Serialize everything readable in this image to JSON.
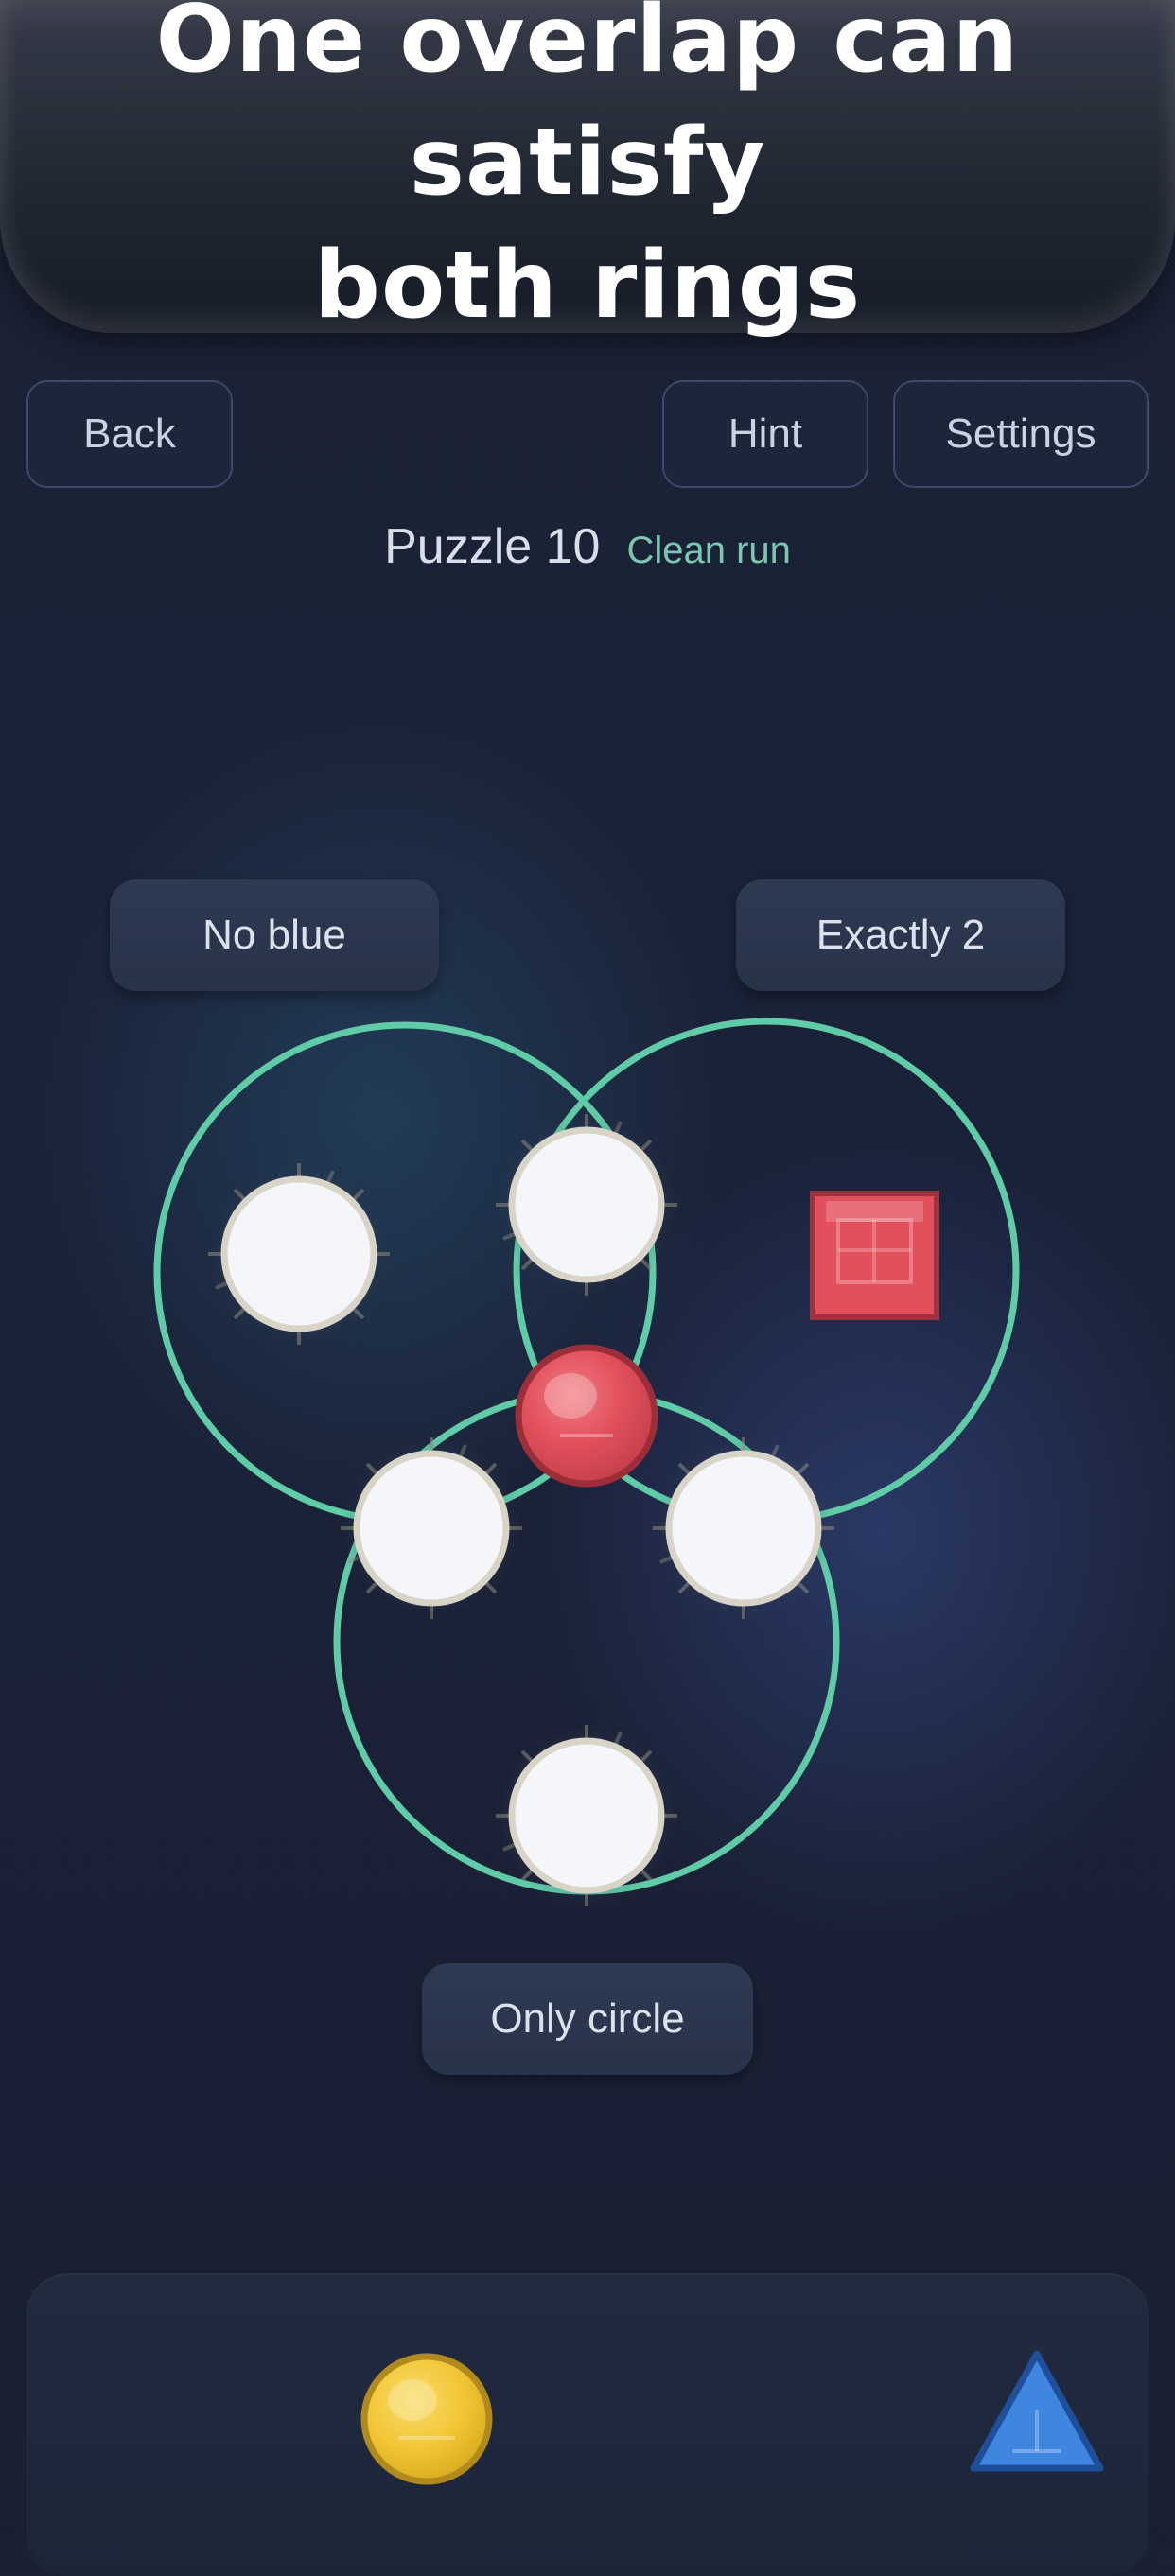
{
  "caption": {
    "line1": "One overlap can satisfy",
    "line2": "both rings"
  },
  "toolbar": {
    "back_label": "Back",
    "hint_label": "Hint",
    "settings_label": "Settings"
  },
  "status": {
    "puzzle_title": "Puzzle 10",
    "tag": "Clean run"
  },
  "rules": {
    "left": "No blue",
    "right": "Exactly 2",
    "bottom": "Only circle"
  },
  "colors": {
    "ring": "#5fcca7",
    "red_piece": "#e2505c",
    "yellow_piece": "#f2c636",
    "blue_piece": "#3f86e0",
    "empty_slot": "#f5f6fa"
  },
  "board": {
    "rings": [
      "left-ring",
      "right-ring",
      "bottom-ring"
    ],
    "slots": [
      {
        "name": "slot-left-only",
        "state": "empty"
      },
      {
        "name": "slot-left-right-overlap",
        "state": "empty"
      },
      {
        "name": "slot-left-bottom-overlap",
        "state": "empty"
      },
      {
        "name": "slot-center",
        "state": "filled",
        "piece": "red-circle"
      },
      {
        "name": "slot-right-bottom-overlap",
        "state": "empty"
      },
      {
        "name": "slot-bottom-only",
        "state": "empty"
      }
    ],
    "placed_pieces": [
      {
        "name": "red-circle-piece",
        "shape": "circle",
        "color": "red"
      },
      {
        "name": "red-square-piece",
        "shape": "square",
        "color": "red"
      }
    ]
  },
  "tray": {
    "pieces": [
      {
        "name": "yellow-circle-piece",
        "shape": "circle",
        "color": "yellow"
      },
      {
        "name": "blue-triangle-piece",
        "shape": "triangle",
        "color": "blue"
      }
    ]
  }
}
